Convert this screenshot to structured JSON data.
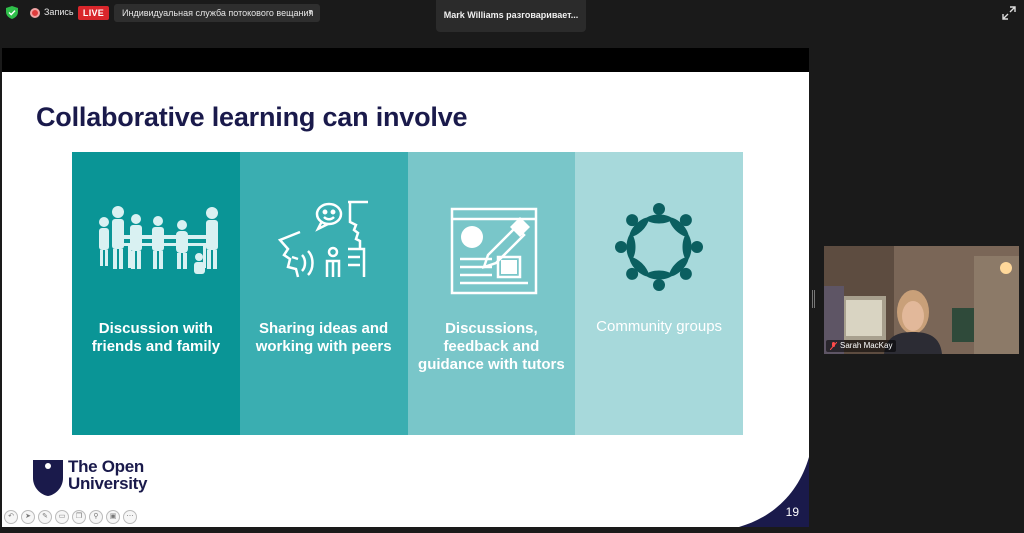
{
  "topbar": {
    "recording_label": "Запись",
    "live_label": "LIVE",
    "stream_option": "Индивидуальная служба потокового вещания",
    "active_speaker": "Mark Williams разговаривает..."
  },
  "slide": {
    "title": "Collaborative learning can involve",
    "panels": [
      {
        "label": "Discussion with friends and family",
        "color": "#0a9596",
        "icon": "group-of-people-icon"
      },
      {
        "label": "Sharing ideas and working with peers",
        "color": "#3aaeb1",
        "icon": "talking-heads-icon"
      },
      {
        "label": "Discussions, feedback and guidance  with tutors",
        "color": "#79c6c9",
        "icon": "document-with-pen-icon"
      },
      {
        "label": "Community groups",
        "color": "#a7d9db",
        "icon": "community-circle-icon"
      }
    ],
    "logo_line1": "The Open",
    "logo_line2": "University",
    "page_number": "19",
    "title_color": "#1a1a4b"
  },
  "participant": {
    "name": "Sarah MacKay"
  }
}
